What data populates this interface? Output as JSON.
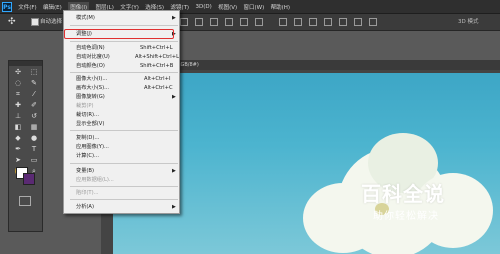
{
  "menubar": {
    "logo": "Ps",
    "items": [
      "文件(F)",
      "编辑(E)",
      "图像(I)",
      "图层(L)",
      "文字(Y)",
      "选择(S)",
      "滤镜(T)",
      "3D(D)",
      "视图(V)",
      "窗口(W)",
      "帮助(H)"
    ]
  },
  "options": {
    "auto_select": "自动选择",
    "mode3d": "3D 模式"
  },
  "document": {
    "tab_title": "RGB/8#)"
  },
  "image_menu": {
    "items": [
      {
        "label": "模式(M)",
        "shortcut": "",
        "submenu": true,
        "disabled": false
      },
      {
        "label": "调整(J)",
        "shortcut": "",
        "submenu": true,
        "disabled": false
      },
      {
        "label": "自动色调(N)",
        "shortcut": "Shift+Ctrl+L",
        "submenu": false,
        "disabled": false
      },
      {
        "label": "自动对比度(U)",
        "shortcut": "Alt+Shift+Ctrl+L",
        "submenu": false,
        "disabled": false
      },
      {
        "label": "自动颜色(O)",
        "shortcut": "Shift+Ctrl+B",
        "submenu": false,
        "disabled": false
      },
      {
        "label": "图像大小(I)...",
        "shortcut": "Alt+Ctrl+I",
        "submenu": false,
        "disabled": false
      },
      {
        "label": "画布大小(S)...",
        "shortcut": "Alt+Ctrl+C",
        "submenu": false,
        "disabled": false
      },
      {
        "label": "图像旋转(G)",
        "shortcut": "",
        "submenu": true,
        "disabled": false
      },
      {
        "label": "裁剪(P)",
        "shortcut": "",
        "submenu": false,
        "disabled": true
      },
      {
        "label": "裁切(R)...",
        "shortcut": "",
        "submenu": false,
        "disabled": false
      },
      {
        "label": "显示全部(V)",
        "shortcut": "",
        "submenu": false,
        "disabled": false
      },
      {
        "label": "复制(D)...",
        "shortcut": "",
        "submenu": false,
        "disabled": false
      },
      {
        "label": "应用图像(Y)...",
        "shortcut": "",
        "submenu": false,
        "disabled": false
      },
      {
        "label": "计算(C)...",
        "shortcut": "",
        "submenu": false,
        "disabled": false
      },
      {
        "label": "变量(B)",
        "shortcut": "",
        "submenu": true,
        "disabled": false
      },
      {
        "label": "应用数据组(L)...",
        "shortcut": "",
        "submenu": false,
        "disabled": true
      },
      {
        "label": "陷印(T)...",
        "shortcut": "",
        "submenu": false,
        "disabled": true
      },
      {
        "label": "分析(A)",
        "shortcut": "",
        "submenu": true,
        "disabled": false
      }
    ]
  },
  "watermark": {
    "title": "百科全说",
    "subtitle": "助你轻松解决"
  },
  "colors": {
    "foreground": "#ffffff",
    "background": "#5a2a73",
    "highlight": "#e03030"
  }
}
